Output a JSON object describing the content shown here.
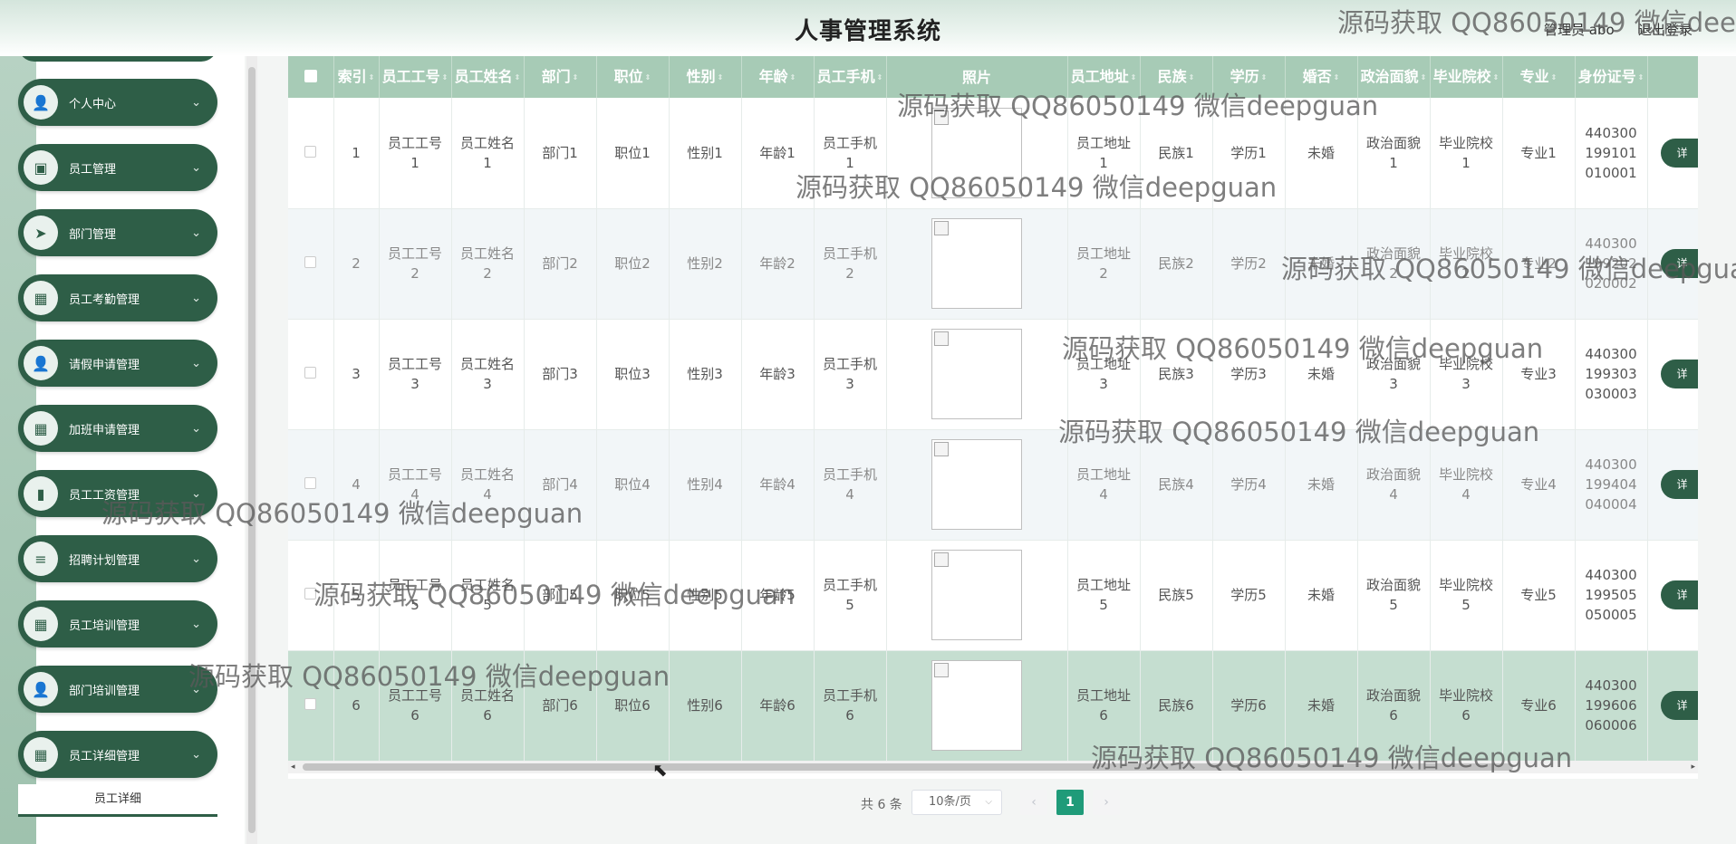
{
  "header": {
    "title": "人事管理系统",
    "admin": "管理员 abo",
    "logout": "退出登录"
  },
  "sidebar": {
    "items": [
      {
        "label": "个人中心",
        "icon": "user-icon"
      },
      {
        "label": "员工管理",
        "icon": "briefcase-icon"
      },
      {
        "label": "部门管理",
        "icon": "send-icon"
      },
      {
        "label": "员工考勤管理",
        "icon": "grid-icon"
      },
      {
        "label": "请假申请管理",
        "icon": "user-icon"
      },
      {
        "label": "加班申请管理",
        "icon": "grid-icon"
      },
      {
        "label": "员工工资管理",
        "icon": "bar-chart-icon"
      },
      {
        "label": "招聘计划管理",
        "icon": "list-icon"
      },
      {
        "label": "员工培训管理",
        "icon": "grid-icon"
      },
      {
        "label": "部门培训管理",
        "icon": "user-icon"
      },
      {
        "label": "员工详细管理",
        "icon": "grid-icon"
      }
    ],
    "subitem": "员工详细"
  },
  "table": {
    "headers": [
      "",
      "索引",
      "员工工号",
      "员工姓名",
      "部门",
      "职位",
      "性别",
      "年龄",
      "员工手机",
      "照片",
      "员工地址",
      "民族",
      "学历",
      "婚否",
      "政治面貌",
      "毕业院校",
      "专业",
      "身份证号",
      ""
    ],
    "rows": [
      {
        "index": "1",
        "no": "员工工号1",
        "name": "员工姓名1",
        "dept": "部门1",
        "pos": "职位1",
        "sex": "性别1",
        "age": "年龄1",
        "phone": "员工手机1",
        "addr": "员工地址1",
        "nation": "民族1",
        "edu": "学历1",
        "married": "未婚",
        "political": "政治面貌1",
        "school": "毕业院校1",
        "major": "专业1",
        "idcard": "440300199101010001"
      },
      {
        "index": "2",
        "no": "员工工号2",
        "name": "员工姓名2",
        "dept": "部门2",
        "pos": "职位2",
        "sex": "性别2",
        "age": "年龄2",
        "phone": "员工手机2",
        "addr": "员工地址2",
        "nation": "民族2",
        "edu": "学历2",
        "married": "未婚",
        "political": "政治面貌2",
        "school": "毕业院校2",
        "major": "专业2",
        "idcard": "440300199202020002"
      },
      {
        "index": "3",
        "no": "员工工号3",
        "name": "员工姓名3",
        "dept": "部门3",
        "pos": "职位3",
        "sex": "性别3",
        "age": "年龄3",
        "phone": "员工手机3",
        "addr": "员工地址3",
        "nation": "民族3",
        "edu": "学历3",
        "married": "未婚",
        "political": "政治面貌3",
        "school": "毕业院校3",
        "major": "专业3",
        "idcard": "440300199303030003"
      },
      {
        "index": "4",
        "no": "员工工号4",
        "name": "员工姓名4",
        "dept": "部门4",
        "pos": "职位4",
        "sex": "性别4",
        "age": "年龄4",
        "phone": "员工手机4",
        "addr": "员工地址4",
        "nation": "民族4",
        "edu": "学历4",
        "married": "未婚",
        "political": "政治面貌4",
        "school": "毕业院校4",
        "major": "专业4",
        "idcard": "440300199404040004"
      },
      {
        "index": "5",
        "no": "员工工号5",
        "name": "员工姓名5",
        "dept": "部门5",
        "pos": "职位5",
        "sex": "性别5",
        "age": "年龄5",
        "phone": "员工手机5",
        "addr": "员工地址5",
        "nation": "民族5",
        "edu": "学历5",
        "married": "未婚",
        "political": "政治面貌5",
        "school": "毕业院校5",
        "major": "专业5",
        "idcard": "440300199505050005"
      },
      {
        "index": "6",
        "no": "员工工号6",
        "name": "员工姓名6",
        "dept": "部门6",
        "pos": "职位6",
        "sex": "性别6",
        "age": "年龄6",
        "phone": "员工手机6",
        "addr": "员工地址6",
        "nation": "民族6",
        "edu": "学历6",
        "married": "未婚",
        "political": "政治面貌6",
        "school": "毕业院校6",
        "major": "专业6",
        "idcard": "440300199606060006"
      }
    ],
    "op_label": "详"
  },
  "pager": {
    "total": "共 6 条",
    "size": "10条/页",
    "page": "1"
  },
  "watermark": "源码获取 QQ86050149 微信deepguan",
  "colors": {
    "primary": "#2e5e47",
    "header_row": "#a7cbb6",
    "active_row": "#c5ded0",
    "page_active": "#1f9b79"
  }
}
